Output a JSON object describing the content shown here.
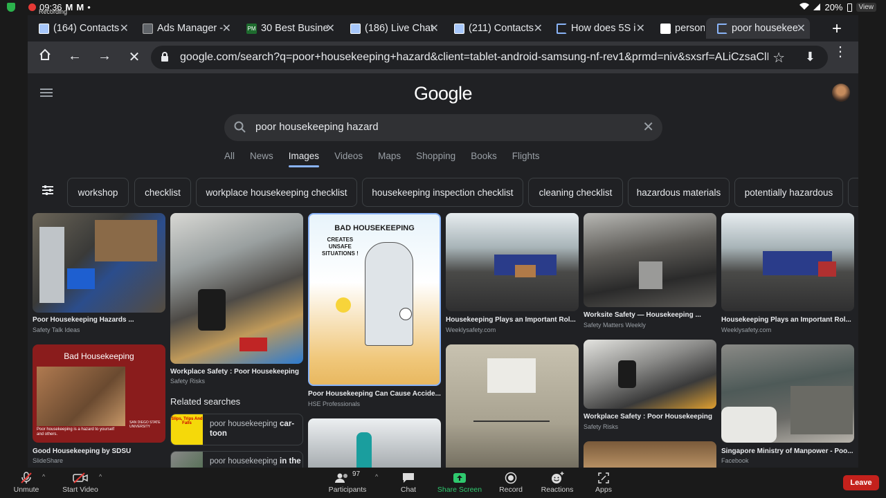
{
  "status_bar": {
    "time": "09:36",
    "recording": "Recording",
    "mail1": "M",
    "mail2": "M",
    "dot": "•",
    "battery": "20%",
    "view": "View"
  },
  "tabs": [
    {
      "title": "(164) Contacts"
    },
    {
      "title": "Ads Manager -"
    },
    {
      "title": "30 Best Busine"
    },
    {
      "title": "(186) Live Chat"
    },
    {
      "title": "(211) Contacts"
    },
    {
      "title": "How does 5S i"
    },
    {
      "title": "personal"
    },
    {
      "title": "poor housekee"
    }
  ],
  "toolbar": {
    "url": "google.com/search?q=poor+housekeeping+hazard&client=tablet-android-samsung-nf-rev1&prmd=niv&sxsrf=ALiCzsaClEW"
  },
  "google": {
    "logo": "Google",
    "query": "poor housekeeping hazard",
    "nav": [
      "All",
      "News",
      "Images",
      "Videos",
      "Maps",
      "Shopping",
      "Books",
      "Flights"
    ],
    "chips": [
      "workshop",
      "checklist",
      "workplace housekeeping checklist",
      "housekeeping inspection checklist",
      "cleaning checklist",
      "hazardous materials",
      "potentially hazardous"
    ]
  },
  "results": [
    {
      "caption": "Poor Housekeeping Hazards ...",
      "source": "Safety Talk Ideas"
    },
    {
      "caption": "Workplace Safety : Poor Housekeeping",
      "source": "Safety Risks"
    },
    {
      "caption": "Poor Housekeeping Can Cause Accide...",
      "source": "HSE Professionals"
    },
    {
      "caption": "Housekeeping Plays an Important Rol...",
      "source": "Weeklysafety.com"
    },
    {
      "caption": "Worksite Safety — Housekeeping ...",
      "source": "Safety Matters Weekly"
    },
    {
      "caption": "Housekeeping Plays an Important Rol...",
      "source": "Weeklysafety.com"
    },
    {
      "caption": "Good Housekeeping by SDSU",
      "source": "SlideShare"
    },
    {
      "caption": "Workplace Safety : Poor Housekeeping",
      "source": "Safety Risks"
    },
    {
      "caption": "Singapore Ministry of Manpower - Poo...",
      "source": "Facebook"
    }
  ],
  "image_text": {
    "bad_title": "BAD HOUSEKEEPING",
    "bad_sub1": "CREATES",
    "bad_sub2": "UNSAFE",
    "bad_sub3": "SITUATIONS !",
    "sdsu_title": "Bad Housekeeping",
    "sdsu_note1": "Poor housekeeping is a hazard to yourself",
    "sdsu_note2": "and others.",
    "sdsu_logo1": "SAN DIEGO STATE",
    "sdsu_logo2": "UNIVERSITY",
    "slips_thumb": "Slips, Trips And Falls"
  },
  "related": {
    "heading": "Related searches",
    "items": [
      {
        "prefix": "poor housekeeping ",
        "bold": "car-",
        "bold2": "toon"
      },
      {
        "prefix": "poor housekeeping ",
        "bold": "in the",
        "bold2": ""
      }
    ]
  },
  "zoom": {
    "unmute": "Unmute",
    "start_video": "Start Video",
    "participants": "Participants",
    "participant_count": "97",
    "chat": "Chat",
    "share_screen": "Share Screen",
    "record": "Record",
    "reactions": "Reactions",
    "apps": "Apps",
    "leave": "Leave"
  }
}
